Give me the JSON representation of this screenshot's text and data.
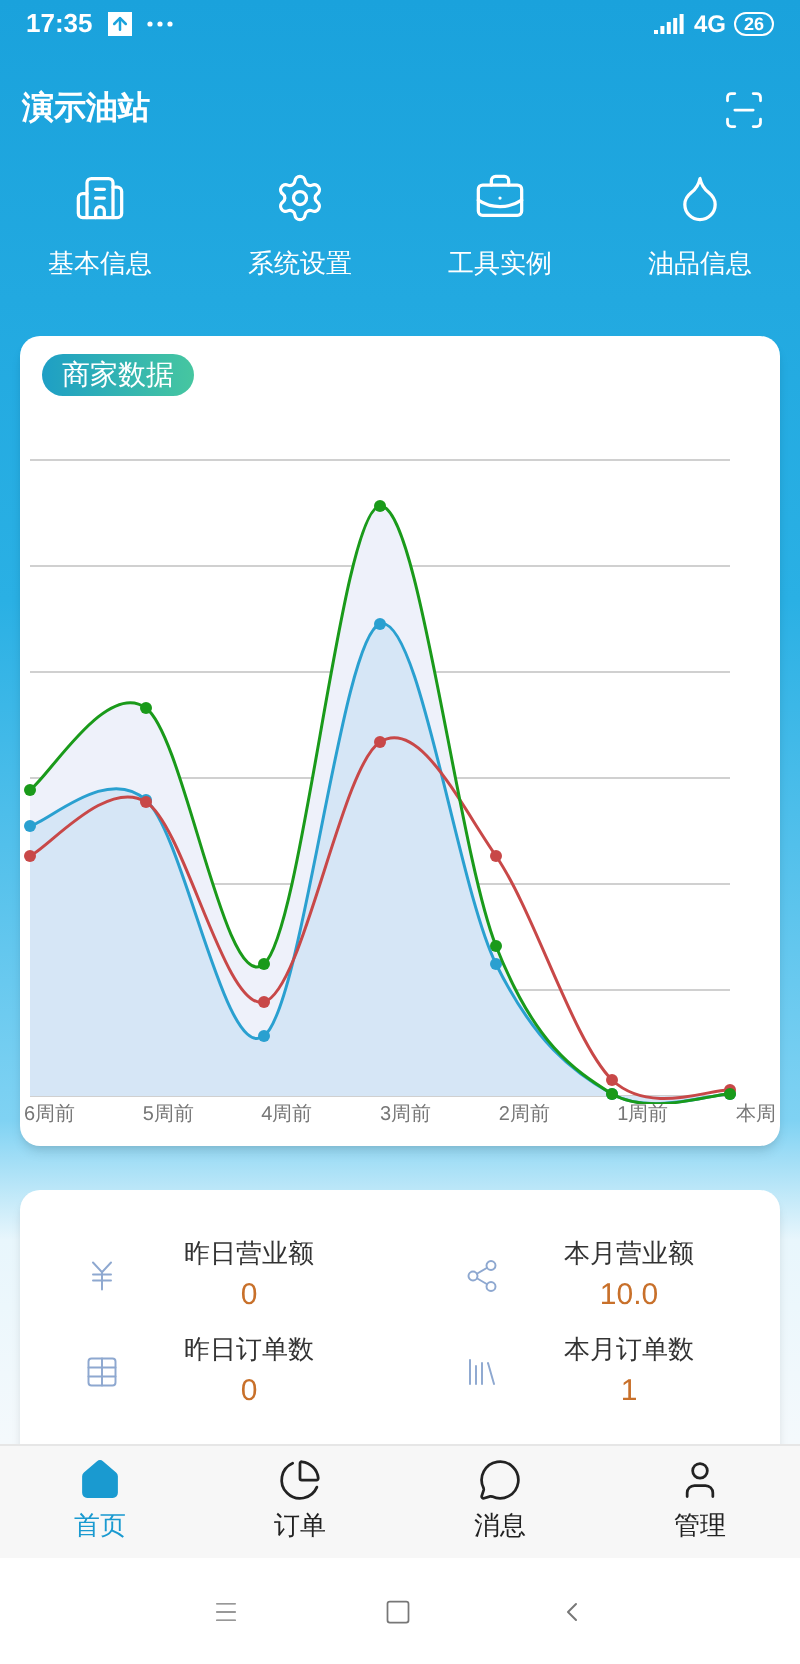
{
  "status_bar": {
    "time": "17:35",
    "network": "4G",
    "battery": "26"
  },
  "header": {
    "title": "演示油站"
  },
  "shortcuts": [
    {
      "label": "基本信息",
      "kind": "building"
    },
    {
      "label": "系统设置",
      "kind": "gear"
    },
    {
      "label": "工具实例",
      "kind": "toolbox"
    },
    {
      "label": "油品信息",
      "kind": "drop"
    }
  ],
  "chart_card": {
    "badge": "商家数据",
    "x_labels": [
      "6周前",
      "5周前",
      "4周前",
      "3周前",
      "2周前",
      "1周前",
      "本周"
    ]
  },
  "stats": [
    {
      "label": "昨日营业额",
      "value": "0",
      "kind": "yuan"
    },
    {
      "label": "本月营业额",
      "value": "10.0",
      "kind": "share"
    },
    {
      "label": "昨日订单数",
      "value": "0",
      "kind": "table"
    },
    {
      "label": "本月订单数",
      "value": "1",
      "kind": "books"
    }
  ],
  "tab_bar": [
    {
      "label": "首页",
      "kind": "home",
      "selected": true
    },
    {
      "label": "订单",
      "kind": "pie",
      "selected": false
    },
    {
      "label": "消息",
      "kind": "chat",
      "selected": false
    },
    {
      "label": "管理",
      "kind": "user",
      "selected": false
    }
  ]
}
